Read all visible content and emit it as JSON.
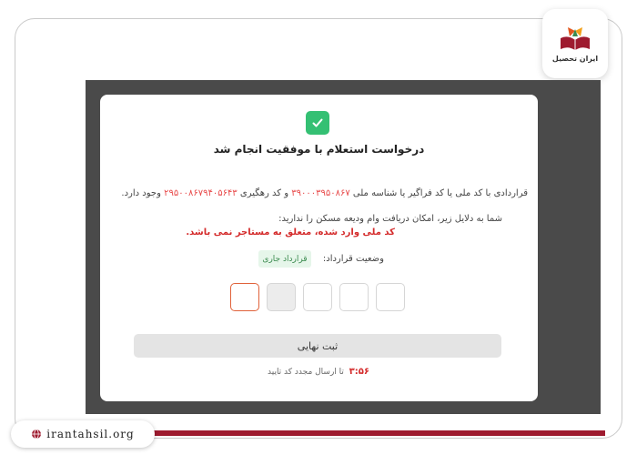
{
  "brand": {
    "logo_name": "ایران تحصیل",
    "site_url": "irantahsil.org",
    "accent": "#9e1b2f"
  },
  "modal": {
    "icon": "check-icon",
    "title": "درخواست استعلام با موفقیت انجام شد",
    "info_prefix": "قراردادی با کد ملی یا کد فراگیر یا شناسه ملی",
    "masked_id_1": "۳۹۰۰۰۳۹۵۰۸۶۷",
    "info_middle": "و کد رهگیری",
    "masked_id_2": "۲۹۵۰۰۸۶۷۹۴۰۵۶۴۳",
    "info_suffix": "وجود دارد.",
    "reason_intro": "شما به دلایل زیر، امکان دریافت وام ودیعه مسکن را ندارید:",
    "reason_error": "کد ملی وارد شده، متعلق به مستاجر نمی باشد.",
    "status_label": "وضعیت قرارداد:",
    "status_badge": "قرارداد جاری",
    "otp_count": 5,
    "submit_label": "ثبت نهایی",
    "timer": "۳:۵۶",
    "resend_text": "تا ارسال مجدد کد تایید"
  },
  "colors": {
    "success": "#34c073",
    "error": "#d42b2b",
    "active_input": "#e0623a",
    "badge_bg": "#e6f6ea",
    "badge_text": "#3a8a4e"
  }
}
